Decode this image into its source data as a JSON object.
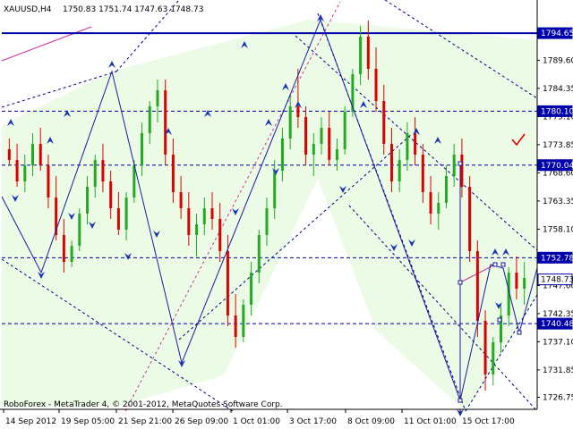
{
  "header": {
    "symbol": "XAUUSD,H4",
    "ohlc": "1750.83 1751.74 1747.63 1748.73"
  },
  "footer": {
    "copyright": "RoboForex - MetaTrader 4, © 2001-2012, MetaQuotes Software Corp."
  },
  "colors": {
    "bull": "#22aa22",
    "bear": "#dd0000",
    "wave": "#1a1aa0",
    "fan": "#cc3399",
    "level": "#0000aa",
    "zone_fill": "#ecfbe6",
    "label_bg": "#0000aa",
    "check_mark": "#dd0000"
  },
  "chart_data": {
    "type": "candlestick",
    "symbol": "XAUUSD",
    "timeframe": "H4",
    "y_axis_ticks": [
      1789.6,
      1784.35,
      1779.1,
      1773.85,
      1768.6,
      1763.35,
      1758.1,
      1752.85,
      1747.6,
      1742.35,
      1737.1,
      1731.85,
      1726.75
    ],
    "x_axis_ticks": [
      "14 Sep 2012",
      "19 Sep 05:00",
      "21 Sep 21:00",
      "26 Sep 09:00",
      "1 Oct 01:00",
      "3 Oct 17:00",
      "8 Oct 09:00",
      "11 Oct 01:00",
      "15 Oct 17:00"
    ],
    "levels": [
      {
        "price": 1794.65,
        "label": "1794.65",
        "style": "solid"
      },
      {
        "price": 1780.1,
        "label": "1780.10",
        "style": "dashed"
      },
      {
        "price": 1770.04,
        "label": "1770.04",
        "style": "dashed"
      },
      {
        "price": 1752.78,
        "label": "1752.78",
        "style": "dashed"
      },
      {
        "price": 1748.73,
        "label": "1748.73",
        "style": "current"
      },
      {
        "price": 1740.48,
        "label": "1740.48",
        "style": "dashed"
      }
    ],
    "y_range": [
      1724.5,
      1800.5
    ],
    "candles": [
      [
        1773,
        1775,
        1770,
        1771
      ],
      [
        1771,
        1774,
        1766,
        1767
      ],
      [
        1767,
        1772,
        1765,
        1770
      ],
      [
        1770,
        1776,
        1768,
        1774
      ],
      [
        1774,
        1777,
        1769,
        1770
      ],
      [
        1770,
        1772,
        1762,
        1764
      ],
      [
        1764,
        1768,
        1756,
        1757
      ],
      [
        1757,
        1760,
        1750,
        1752
      ],
      [
        1752,
        1756,
        1751,
        1755
      ],
      [
        1755,
        1762,
        1754,
        1761
      ],
      [
        1761,
        1768,
        1759,
        1766
      ],
      [
        1766,
        1772,
        1764,
        1771
      ],
      [
        1771,
        1774,
        1765,
        1767
      ],
      [
        1767,
        1769,
        1760,
        1762
      ],
      [
        1762,
        1765,
        1757,
        1758
      ],
      [
        1758,
        1765,
        1756,
        1764
      ],
      [
        1764,
        1771,
        1763,
        1770
      ],
      [
        1770,
        1778,
        1768,
        1776
      ],
      [
        1776,
        1782,
        1774,
        1781
      ],
      [
        1781,
        1786,
        1778,
        1784
      ],
      [
        1784,
        1786,
        1770,
        1772
      ],
      [
        1772,
        1775,
        1763,
        1765
      ],
      [
        1765,
        1768,
        1760,
        1762
      ],
      [
        1762,
        1765,
        1755,
        1757
      ],
      [
        1757,
        1761,
        1753,
        1759
      ],
      [
        1759,
        1764,
        1757,
        1762
      ],
      [
        1762,
        1765,
        1758,
        1760
      ],
      [
        1760,
        1763,
        1752,
        1754
      ],
      [
        1754,
        1757,
        1740,
        1742
      ],
      [
        1742,
        1746,
        1736,
        1738
      ],
      [
        1738,
        1745,
        1737,
        1744
      ],
      [
        1744,
        1752,
        1742,
        1750
      ],
      [
        1750,
        1758,
        1748,
        1757
      ],
      [
        1757,
        1764,
        1755,
        1762
      ],
      [
        1762,
        1771,
        1760,
        1769
      ],
      [
        1769,
        1777,
        1767,
        1775
      ],
      [
        1775,
        1783,
        1773,
        1781
      ],
      [
        1781,
        1788,
        1777,
        1779
      ],
      [
        1779,
        1781,
        1770,
        1772
      ],
      [
        1772,
        1776,
        1768,
        1774
      ],
      [
        1774,
        1779,
        1772,
        1777
      ],
      [
        1777,
        1780,
        1770,
        1771
      ],
      [
        1771,
        1775,
        1769,
        1773
      ],
      [
        1773,
        1781,
        1772,
        1780
      ],
      [
        1780,
        1788,
        1779,
        1787
      ],
      [
        1787,
        1796,
        1785,
        1794
      ],
      [
        1794,
        1797,
        1786,
        1788
      ],
      [
        1788,
        1792,
        1780,
        1782
      ],
      [
        1782,
        1785,
        1772,
        1774
      ],
      [
        1774,
        1777,
        1765,
        1767
      ],
      [
        1767,
        1773,
        1765,
        1771
      ],
      [
        1771,
        1778,
        1769,
        1776
      ],
      [
        1776,
        1779,
        1770,
        1772
      ],
      [
        1772,
        1774,
        1763,
        1765
      ],
      [
        1765,
        1768,
        1759,
        1761
      ],
      [
        1761,
        1765,
        1758,
        1763
      ],
      [
        1763,
        1770,
        1762,
        1768
      ],
      [
        1768,
        1774,
        1766,
        1772
      ],
      [
        1772,
        1775,
        1764,
        1766
      ],
      [
        1766,
        1768,
        1752,
        1754
      ],
      [
        1754,
        1756,
        1738,
        1741
      ],
      [
        1741,
        1743,
        1728,
        1731
      ],
      [
        1731,
        1738,
        1729,
        1737
      ],
      [
        1737,
        1744,
        1735,
        1742
      ],
      [
        1742,
        1751,
        1740,
        1750
      ],
      [
        1750,
        1753,
        1745,
        1747
      ],
      [
        1747,
        1752,
        1744,
        1749
      ]
    ]
  }
}
